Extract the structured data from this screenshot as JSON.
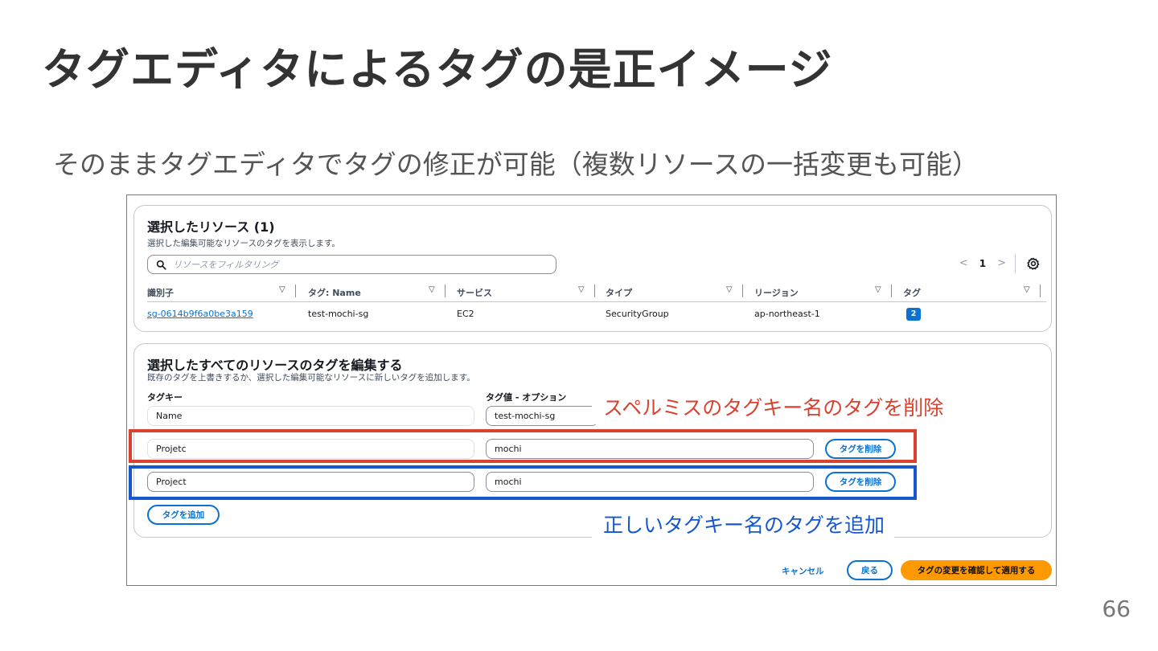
{
  "slide": {
    "title": "タグエディタによるタグの是正イメージ",
    "subtitle": "そのままタグエディタでタグの修正が可能（複数リソースの一括変更も可能）",
    "page_number": "66"
  },
  "resources_panel": {
    "heading": "選択したリソース",
    "count": "(1)",
    "description": "選択した編集可能なリソースのタグを表示します。",
    "search_placeholder": "リソースをフィルタリング",
    "pagination": {
      "prev": "<",
      "current": "1",
      "next": ">"
    },
    "columns": [
      "識別子",
      "タグ: Name",
      "サービス",
      "タイプ",
      "リージョン",
      "タグ"
    ],
    "sort_glyph": "▽",
    "row": {
      "identifier": "sg-0614b9f6a0be3a159",
      "tag_name": "test-mochi-sg",
      "service": "EC2",
      "type": "SecurityGroup",
      "region": "ap-northeast-1",
      "tag_count": "2"
    }
  },
  "edit_panel": {
    "heading": "選択したすべてのリソースのタグを編集する",
    "description": "既存のタグを上書きするか、選択した編集可能なリソースに新しいタグを追加します。",
    "key_label": "タグキー",
    "value_label": "タグ値 - オプション",
    "tags": [
      {
        "key": "Name",
        "value": "test-mochi-sg"
      },
      {
        "key": "Projetc",
        "value": "mochi",
        "remove_label": "タグを削除"
      },
      {
        "key": "Project",
        "value": "mochi",
        "remove_label": "タグを削除"
      }
    ],
    "add_label": "タグを追加"
  },
  "footer": {
    "cancel": "キャンセル",
    "back": "戻る",
    "apply": "タグの変更を確認して適用する"
  },
  "annotations": {
    "remove_note": "スペルミスのタグキー名のタグを削除",
    "add_note": "正しいタグキー名のタグを追加",
    "remove_color": "#d9422f",
    "add_color": "#1657cc"
  },
  "colors": {
    "link_blue": "#0972d3",
    "primary_orange": "#ff9900"
  }
}
